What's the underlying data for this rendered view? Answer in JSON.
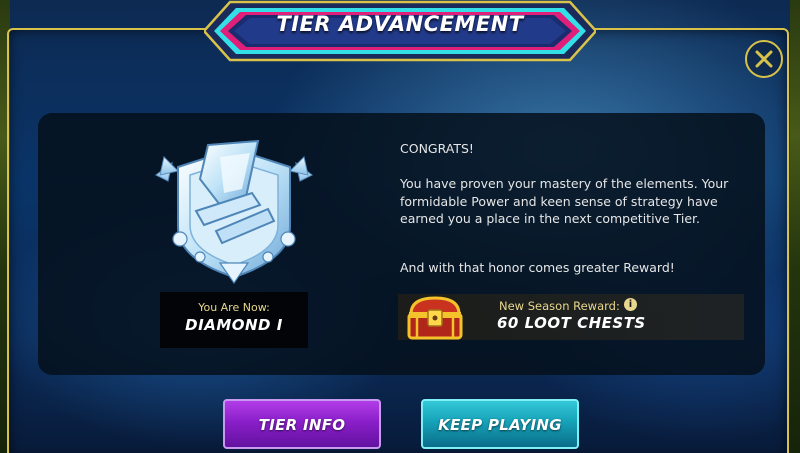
{
  "title": "TIER ADVANCEMENT",
  "rank": {
    "caption": "You Are Now:",
    "name": "DIAMOND I"
  },
  "message": {
    "congrats": "CONGRATS!",
    "body": "You have proven your mastery of the elements. Your formidable Power and keen sense of strategy have earned you a place in the next competitive Tier.",
    "honor": "And with that honor comes greater Reward!"
  },
  "reward": {
    "label": "New Season Reward:",
    "value": "60 LOOT CHESTS",
    "info_icon": "i"
  },
  "buttons": {
    "tier_info": "TIER INFO",
    "keep_playing": "KEEP PLAYING"
  },
  "icons": {
    "close": "close-icon",
    "badge": "diamond-tier-badge-icon",
    "chest": "loot-chest-icon",
    "info": "info-icon"
  },
  "colors": {
    "gold": "#d9c24a",
    "reward_gold": "#e8d78c",
    "purple_button": "#8a1fc9",
    "teal_button": "#16a2b8",
    "panel": "#05101c"
  }
}
